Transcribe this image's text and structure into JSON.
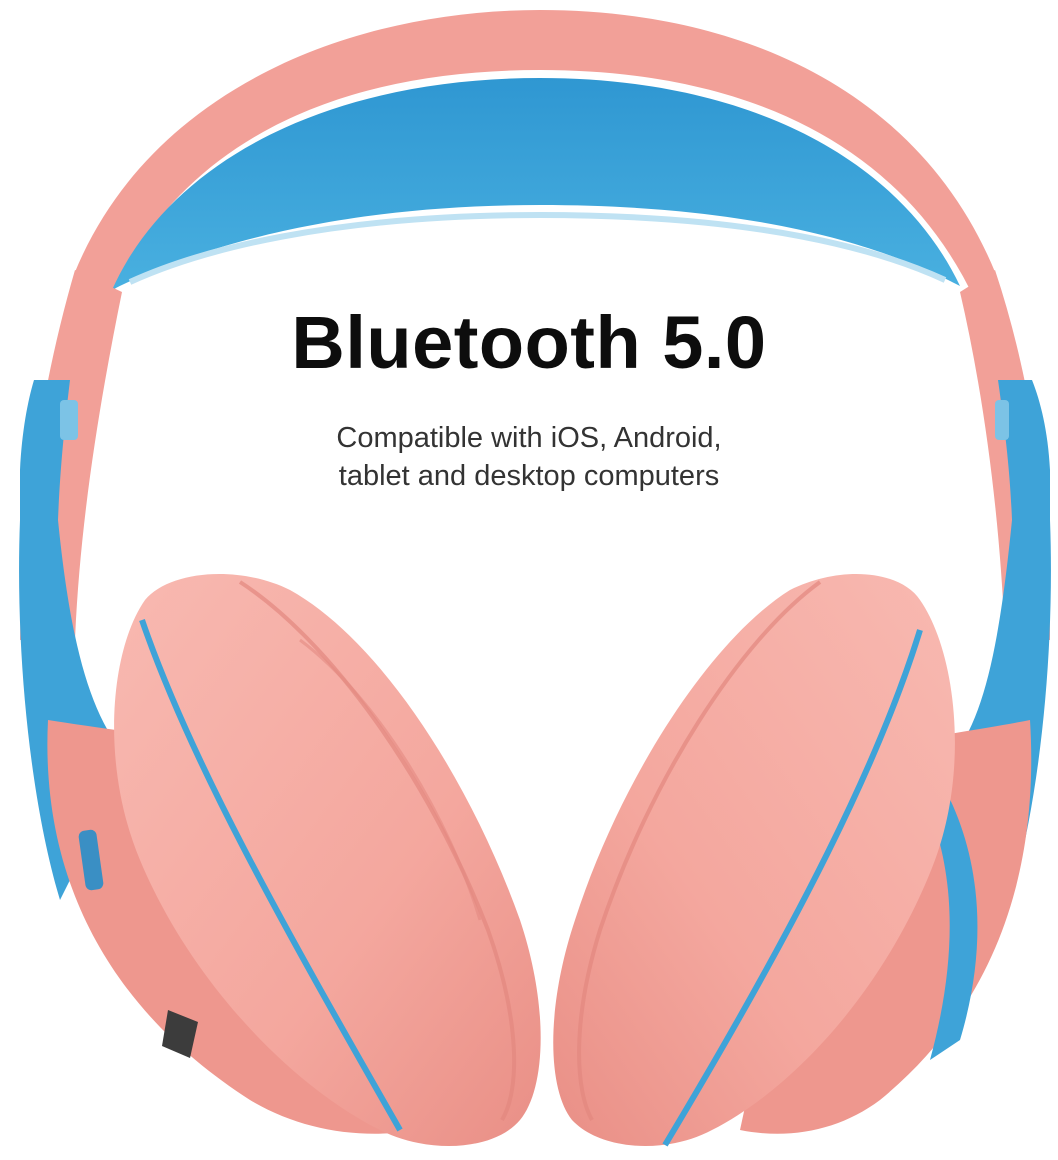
{
  "headline": "Bluetooth 5.0",
  "subline": {
    "line1": "Compatible with iOS, Android,",
    "line2": "tablet and desktop computers"
  },
  "colors": {
    "background": "#ffffff",
    "shell_pink": "#f4a19a",
    "cushion_pink": "#f7b0a8",
    "accent_blue": "#3ea3d8",
    "text": "#0d0d0d",
    "subtext": "#333333"
  }
}
